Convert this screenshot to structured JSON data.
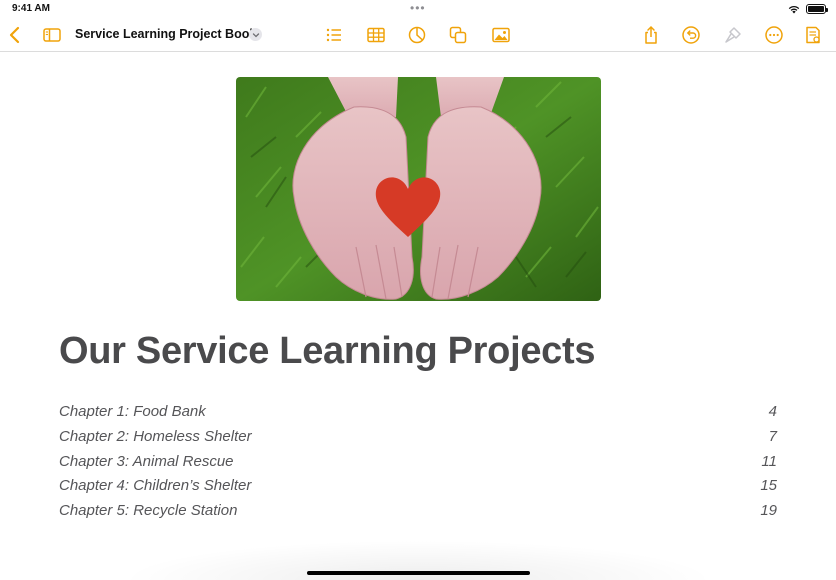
{
  "status": {
    "time": "9:41 AM",
    "dots": "•••"
  },
  "toolbar": {
    "document_title": "Service Learning Project Book",
    "icons": [
      "chevron-left-icon",
      "sidebar-icon",
      "chevron-down-icon",
      "list-icon",
      "table-icon",
      "chart-icon",
      "shape-icon",
      "media-icon",
      "share-icon",
      "undo-icon",
      "brush-icon",
      "more-icon",
      "document-view-icon"
    ]
  },
  "colors": {
    "accent": "#f0a30a",
    "heading": "#4a4a4c",
    "heart": "#d63a26"
  },
  "document": {
    "hero_image": "hands-holding-heart-photo",
    "heading": "Our Service Learning Projects",
    "toc": [
      {
        "title": "Chapter 1: Food Bank",
        "page": "4"
      },
      {
        "title": "Chapter 2: Homeless Shelter",
        "page": "7"
      },
      {
        "title": "Chapter 3: Animal Rescue",
        "page": "11"
      },
      {
        "title": "Chapter 4: Children’s Shelter",
        "page": "15"
      },
      {
        "title": "Chapter 5: Recycle Station",
        "page": "19"
      }
    ]
  }
}
